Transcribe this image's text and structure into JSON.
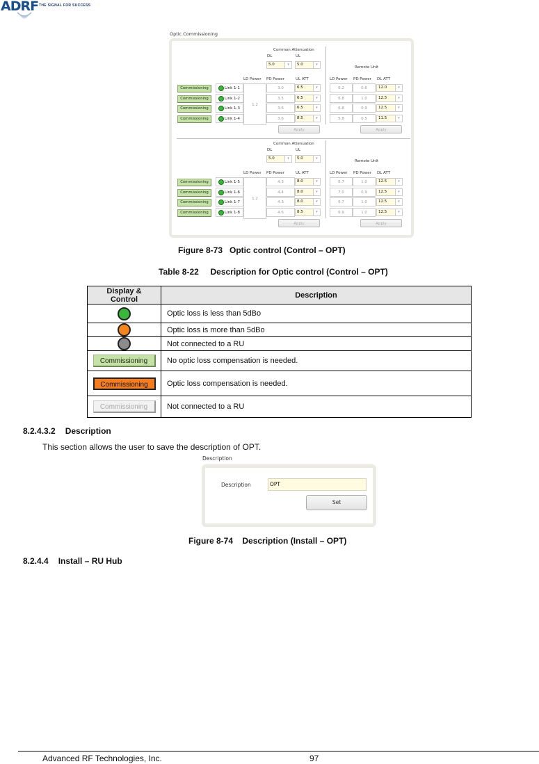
{
  "header": {
    "logo_text": "ADRF",
    "tagline": "THE SIGNAL FOR SUCCESS"
  },
  "figure73": {
    "panel_title": "Optic Commissioning",
    "groups": [
      {
        "common_attenuation_label": "Common Attenuation",
        "dl_label": "DL",
        "ul_label": "UL",
        "dl_value": "5.0",
        "ul_value": "5.0",
        "col_ld_power": "LD Power",
        "col_pd_power": "PD Power",
        "col_ul_att": "UL ATT",
        "ld_power": "1.2",
        "links": [
          {
            "button": "Commissioning",
            "name": "Link 1-1",
            "pd_power": "3.0",
            "ul_att": "6.5",
            "ru_ld_power": "6.2",
            "ru_pd_power": "0.6",
            "ru_dl_att": "12.0"
          },
          {
            "button": "Commissioning",
            "name": "Link 1-2",
            "pd_power": "3.5",
            "ul_att": "6.5",
            "ru_ld_power": "6.8",
            "ru_pd_power": "1.0",
            "ru_dl_att": "12.5"
          },
          {
            "button": "Commissioning",
            "name": "Link 1-3",
            "pd_power": "3.6",
            "ul_att": "6.5",
            "ru_ld_power": "6.8",
            "ru_pd_power": "0.9",
            "ru_dl_att": "12.5"
          },
          {
            "button": "Commissioning",
            "name": "Link 1-4",
            "pd_power": "3.6",
            "ul_att": "8.5",
            "ru_ld_power": "5.8",
            "ru_pd_power": "0.5",
            "ru_dl_att": "11.5"
          }
        ],
        "apply_label": "Apply",
        "remote_unit_label": "Remote Unit",
        "ru_col_ld_power": "LD Power",
        "ru_col_pd_power": "PD Power",
        "ru_col_dl_att": "DL ATT",
        "ru_apply_label": "Apply"
      },
      {
        "common_attenuation_label": "Common Attenuation",
        "dl_label": "DL",
        "ul_label": "UL",
        "dl_value": "5.0",
        "ul_value": "5.0",
        "col_ld_power": "LD Power",
        "col_pd_power": "PD Power",
        "col_ul_att": "UL ATT",
        "ld_power": "1.2",
        "links": [
          {
            "button": "Commissioning",
            "name": "Link 1-5",
            "pd_power": "4.3",
            "ul_att": "8.0",
            "ru_ld_power": "6.7",
            "ru_pd_power": "1.0",
            "ru_dl_att": "12.5"
          },
          {
            "button": "Commissioning",
            "name": "Link 1-6",
            "pd_power": "4.4",
            "ul_att": "8.0",
            "ru_ld_power": "7.0",
            "ru_pd_power": "0.9",
            "ru_dl_att": "12.5"
          },
          {
            "button": "Commissioning",
            "name": "Link 1-7",
            "pd_power": "4.3",
            "ul_att": "8.0",
            "ru_ld_power": "6.7",
            "ru_pd_power": "1.0",
            "ru_dl_att": "12.5"
          },
          {
            "button": "Commissioning",
            "name": "Link 1-8",
            "pd_power": "4.6",
            "ul_att": "8.5",
            "ru_ld_power": "6.9",
            "ru_pd_power": "1.0",
            "ru_dl_att": "12.5"
          }
        ],
        "apply_label": "Apply",
        "remote_unit_label": "Remote Unit",
        "ru_col_ld_power": "LD Power",
        "ru_col_pd_power": "PD Power",
        "ru_col_dl_att": "DL ATT",
        "ru_apply_label": "Apply"
      }
    ],
    "caption": "Figure 8-73   Optic control (Control – OPT)"
  },
  "table": {
    "caption": "Table 8-22     Description for Optic control (Control – OPT)",
    "headers": [
      "Display & Control",
      "Description"
    ],
    "rows": [
      {
        "icon": "green-led",
        "color": "#3cb53c",
        "description": "Optic loss is less than 5dBo"
      },
      {
        "icon": "orange-led",
        "color": "#f5861f",
        "description": "Optic loss is more than 5dBo"
      },
      {
        "icon": "gray-led",
        "color": "#8c8c8c",
        "description": "Not connected to a RU"
      },
      {
        "icon": "commissioning-green",
        "label": "Commissioning",
        "description": "No optic loss compensation is needed."
      },
      {
        "icon": "commissioning-orange",
        "label": "Commissioning",
        "description": "Optic loss compensation is needed."
      },
      {
        "icon": "commissioning-gray",
        "label": "Commissioning",
        "description": "Not connected to a RU"
      }
    ]
  },
  "section_description": {
    "heading_number": "8.2.4.3.2",
    "heading_title": "Description",
    "paragraph": "This section allows the user to save the description of OPT."
  },
  "figure74": {
    "panel_title": "Description",
    "field_label": "Description",
    "field_value": "OPT",
    "set_label": "Set",
    "caption": "Figure 8-74    Description (Install – OPT)"
  },
  "section_install": {
    "heading_number": "8.2.4.4",
    "heading_title": "Install – RU Hub"
  },
  "footer": {
    "company": "Advanced RF Technologies, Inc.",
    "page_number": "97"
  }
}
